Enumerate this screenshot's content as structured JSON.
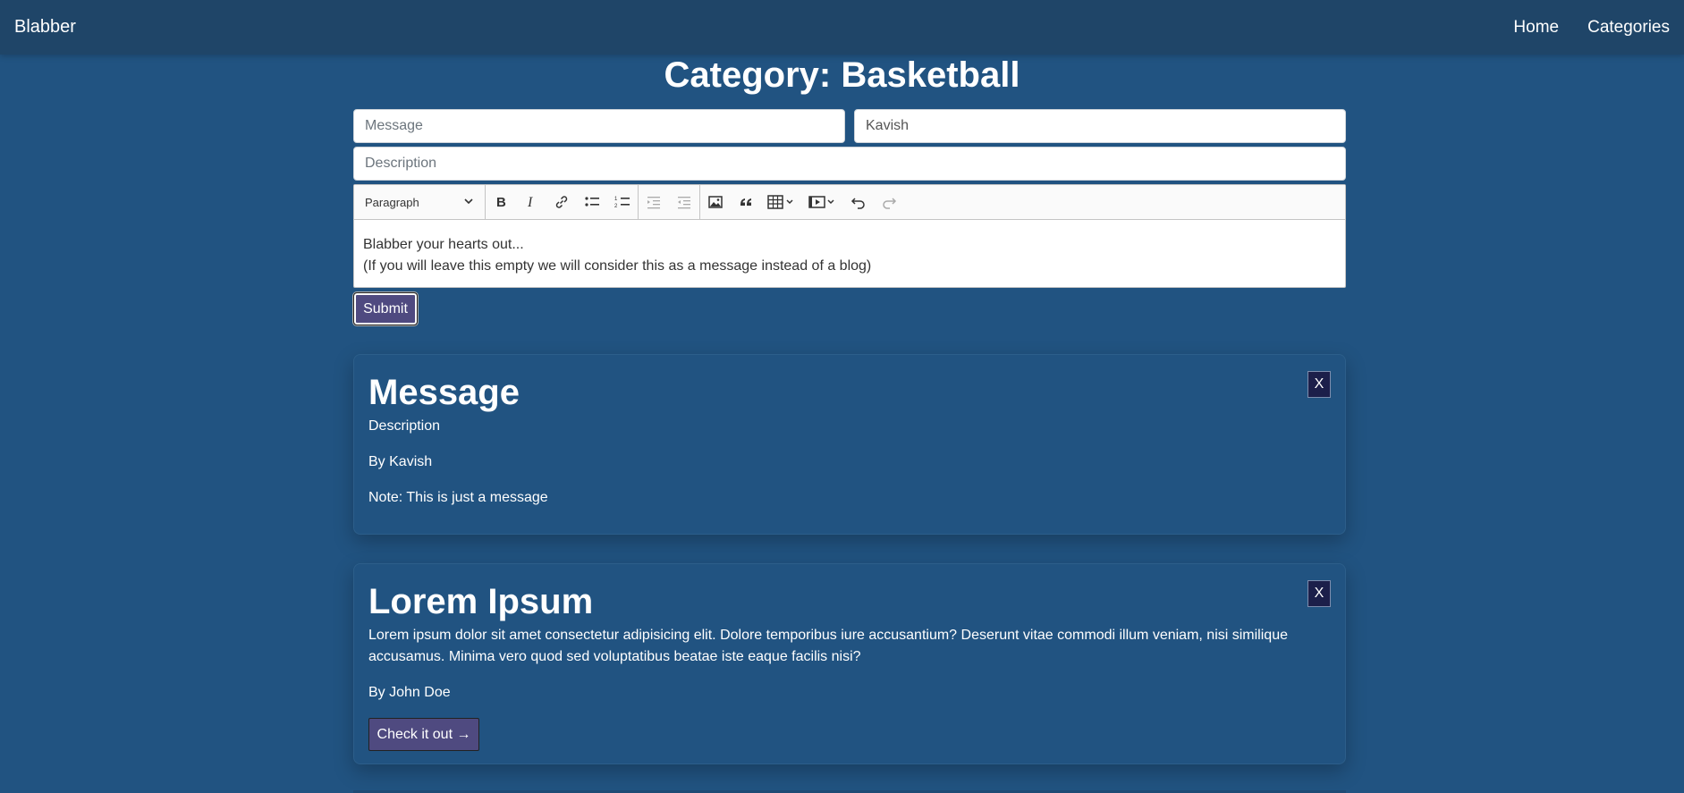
{
  "navbar": {
    "brand": "Blabber",
    "links": [
      "Home",
      "Categories"
    ]
  },
  "page": {
    "title": "Category: Basketball"
  },
  "form": {
    "message_placeholder": "Message",
    "author_value": "Kavish",
    "description_placeholder": "Description",
    "editor": {
      "heading_select": "Paragraph",
      "body_line1": "Blabber your hearts out...",
      "body_line2": "(If you will leave this empty we will consider this as a message instead of a blog)"
    },
    "submit_label": "Submit"
  },
  "posts": [
    {
      "title": "Message",
      "description": "Description",
      "author": "By Kavish",
      "note": "Note: This is just a message",
      "close_label": "X"
    },
    {
      "title": "Lorem Ipsum",
      "description": "Lorem ipsum dolor sit amet consectetur adipisicing elit. Dolore temporibus iure accusantium? Deserunt vitae commodi illum veniam, nisi similique accusamus. Minima vero quod sed voluptatibus beatae iste eaque facilis nisi?",
      "author": "By John Doe",
      "link_label": "Check it out →",
      "close_label": "X"
    }
  ]
}
